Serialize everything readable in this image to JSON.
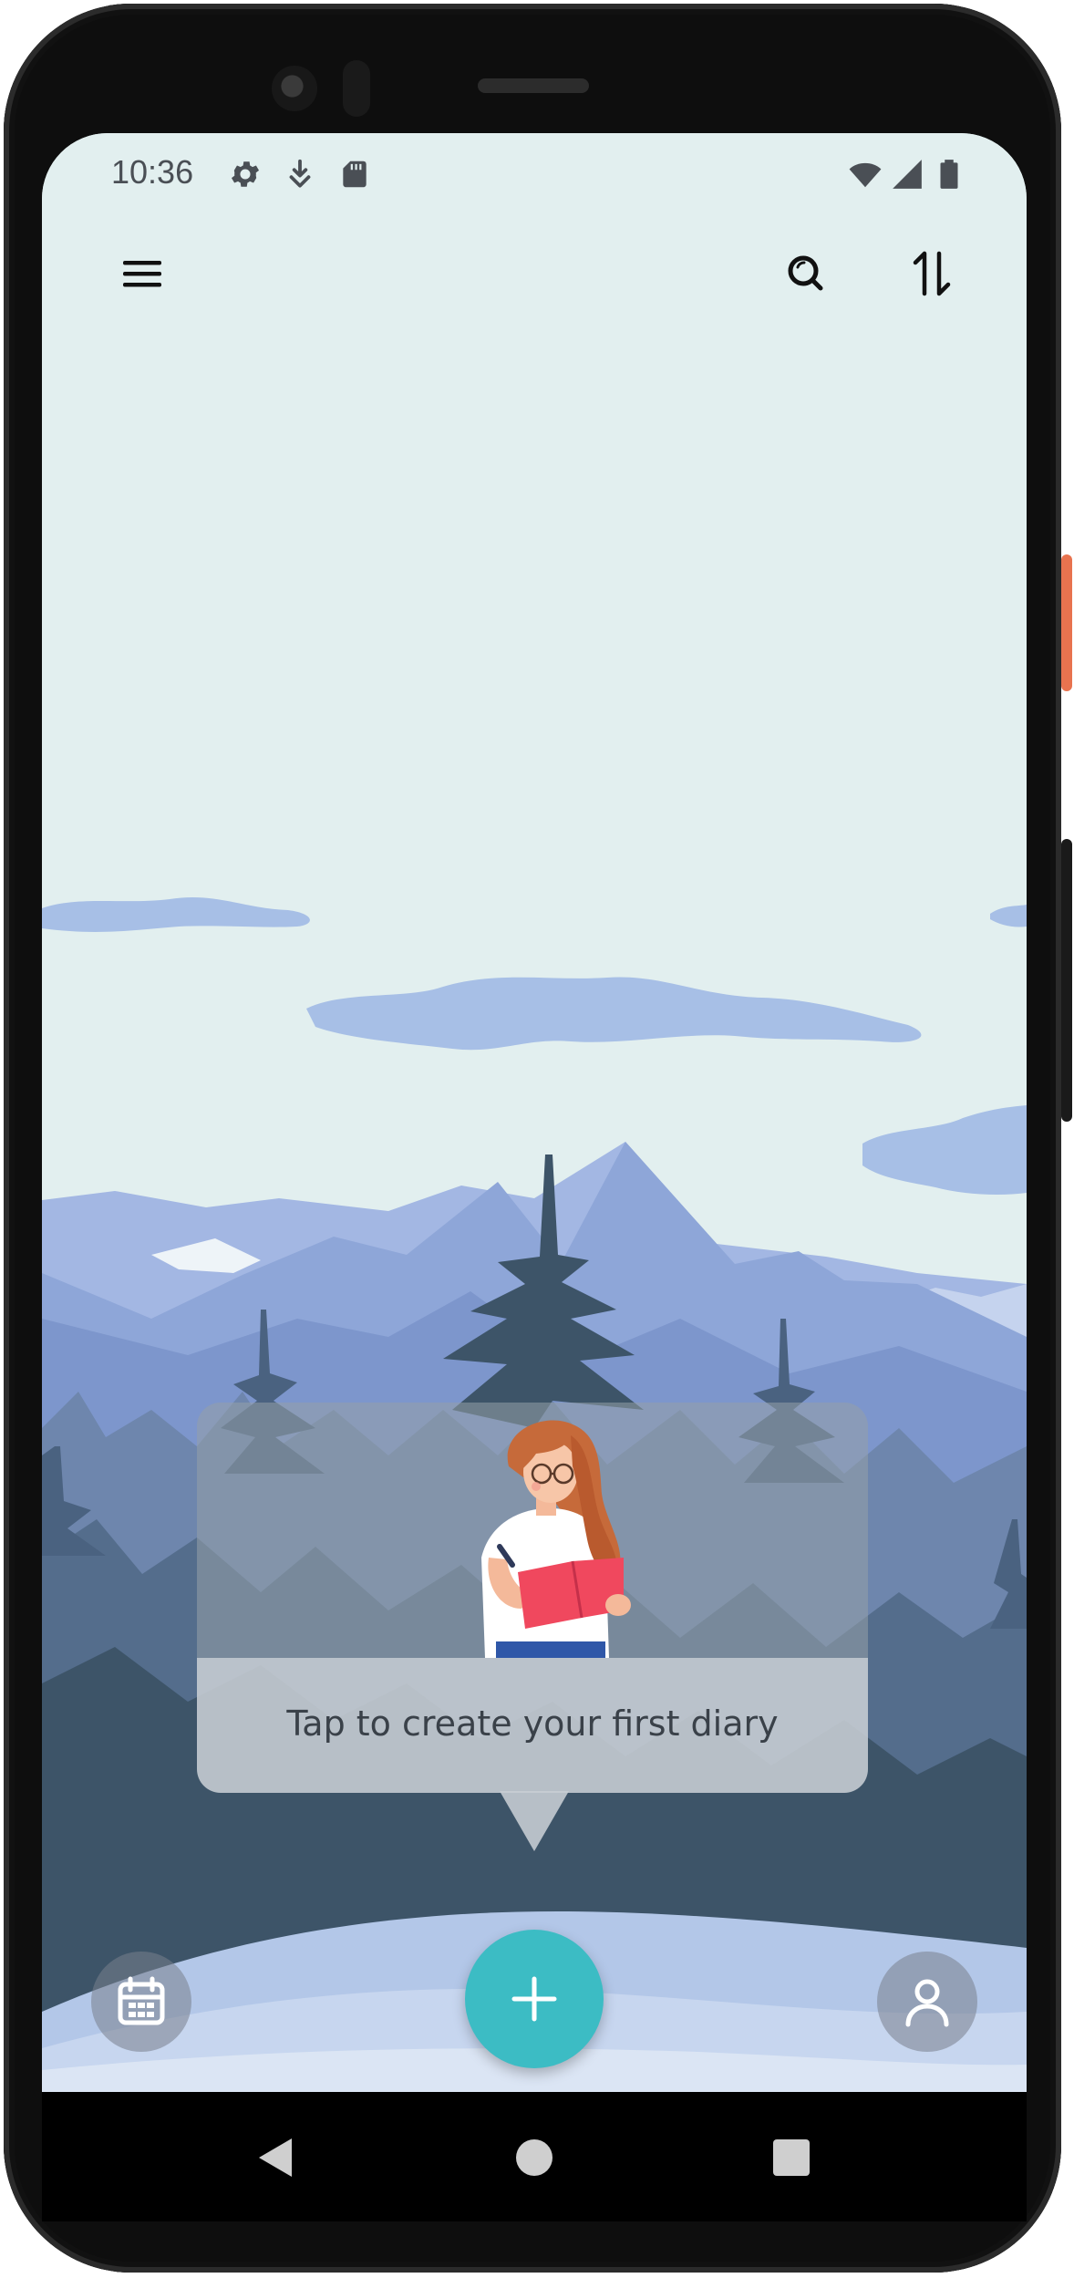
{
  "status_bar": {
    "time": "10:36",
    "left_icons": [
      "gear-icon",
      "download-arrow-icon",
      "sd-card-icon"
    ],
    "right_icons": [
      "wifi-icon",
      "cellular-signal-icon",
      "battery-icon"
    ]
  },
  "toolbar": {
    "menu_icon": "menu-icon",
    "search_icon": "search-icon",
    "sort_icon": "sort-icon"
  },
  "empty_state": {
    "tooltip_text": "Tap to create your first diary",
    "illustration": "girl-writing-diary-illustration"
  },
  "bottom_bar": {
    "calendar_icon": "calendar-icon",
    "add_icon": "plus-icon",
    "profile_icon": "person-icon"
  },
  "colors": {
    "sky": "#e2efef",
    "clouds": "#a7bfe6",
    "mountains": "#8ea6d8",
    "trees_dark": "#3d5468",
    "snow": "#b9cdea",
    "fab": "#3cbcc4",
    "accent_red": "#f0485e"
  },
  "system_nav": [
    "back-icon",
    "home-icon",
    "recents-icon"
  ]
}
